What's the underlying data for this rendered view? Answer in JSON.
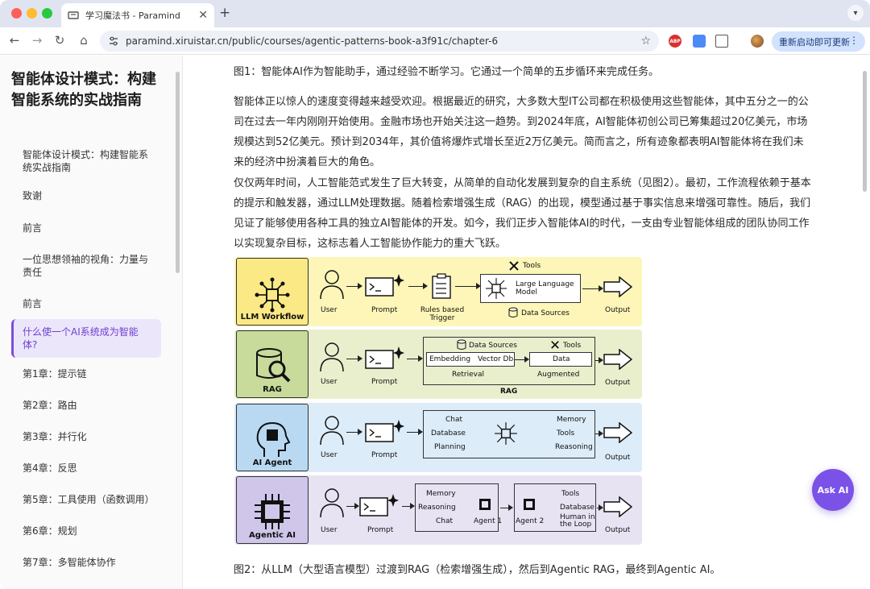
{
  "browser": {
    "tab_title": "学习魔法书 - Paramind",
    "new_tab": "+",
    "tab_close": "✕",
    "url": "paramind.xiruistar.cn/public/courses/agentic-patterns-book-a3f91c/chapter-6",
    "update_label": "重新启动即可更新",
    "ext_abp": "ABP"
  },
  "sidebar": {
    "book_title": "智能体设计模式：构建智能系统的实战指南",
    "items": [
      {
        "label": "智能体设计模式：构建智能系统实战指南"
      },
      {
        "label": "致谢"
      },
      {
        "label": "前言"
      },
      {
        "label": "一位思想领袖的视角：力量与责任"
      },
      {
        "label": "前言"
      },
      {
        "label": "什么使一个AI系统成为智能体?"
      },
      {
        "label": "第1章：提示链"
      },
      {
        "label": "第2章：路由"
      },
      {
        "label": "第3章：并行化"
      },
      {
        "label": "第4章：反思"
      },
      {
        "label": "第5章：工具使用（函数调用）"
      },
      {
        "label": "第6章：规划"
      },
      {
        "label": "第7章：多智能体协作"
      }
    ],
    "active_index": 5
  },
  "main": {
    "caption1": "图1：智能体AI作为智能助手，通过经验不断学习。它通过一个简单的五步循环来完成任务。",
    "para1": "智能体正以惊人的速度变得越来越受欢迎。根据最近的研究，大多数大型IT公司都在积极使用这些智能体，其中五分之一的公司在过去一年内刚刚开始使用。金融市场也开始关注这一趋势。到2024年底，AI智能体初创公司已筹集超过20亿美元，市场规模达到52亿美元。预计到2034年，其价值将爆炸式增长至近2万亿美元。简而言之，所有迹象都表明AI智能体将在我们未来的经济中扮演着巨大的角色。",
    "para2": "仅仅两年时间，人工智能范式发生了巨大转变，从简单的自动化发展到复杂的自主系统（见图2）。最初，工作流程依赖于基本的提示和触发器，通过LLM处理数据。随着检索增强生成（RAG）的出现，模型通过基于事实信息来增强可靠性。随后，我们见证了能够使用各种工具的独立AI智能体的开发。如今，我们正步入智能体AI的时代，一支由专业智能体组成的团队协同工作以实现复杂目标，这标志着人工智能协作能力的重大飞跃。",
    "caption2": "图2：从LLM（大型语言模型）过渡到RAG（检索增强生成），然后到Agentic RAG，最终到Agentic AI。"
  },
  "figure": {
    "rows": [
      {
        "label": "LLM Workflow",
        "color": "#fdf6b8",
        "box": "#fbe986",
        "user": "User",
        "prompt": "Prompt",
        "trigger": "Rules based Trigger",
        "tools": "Tools",
        "model": "Large Language Model",
        "sources": "Data Sources",
        "output": "Output"
      },
      {
        "label": "RAG",
        "color": "#e9efcd",
        "box": "#c8db9a",
        "user": "User",
        "prompt": "Prompt",
        "sources": "Data Sources",
        "tools": "Tools",
        "embedding": "Embedding",
        "vectordb": "Vector Db",
        "data": "Data",
        "retrieval": "Retrieval",
        "augmented": "Augmented",
        "group": "RAG",
        "output": "Output"
      },
      {
        "label": "AI Agent",
        "color": "#dcecf9",
        "box": "#b9d9f3",
        "user": "User",
        "prompt": "Prompt",
        "chat": "Chat",
        "database": "Database",
        "planning": "Planning",
        "memory": "Memory",
        "tools": "Tools",
        "reasoning": "Reasoning",
        "output": "Output"
      },
      {
        "label": "Agentic AI",
        "color": "#e7e3f3",
        "box": "#cfc6ea",
        "user": "User",
        "prompt": "Prompt",
        "memory": "Memory",
        "reasoning": "Reasoning",
        "chat": "Chat",
        "agent1": "Agent 1",
        "agent2": "Agent 2",
        "tools": "Tools",
        "database": "Database",
        "human": "Human in the Loop",
        "output": "Output"
      }
    ]
  },
  "ask_ai": "Ask AI",
  "colors": {
    "accent": "#7b52e8",
    "active_bg": "#ece6fb"
  }
}
